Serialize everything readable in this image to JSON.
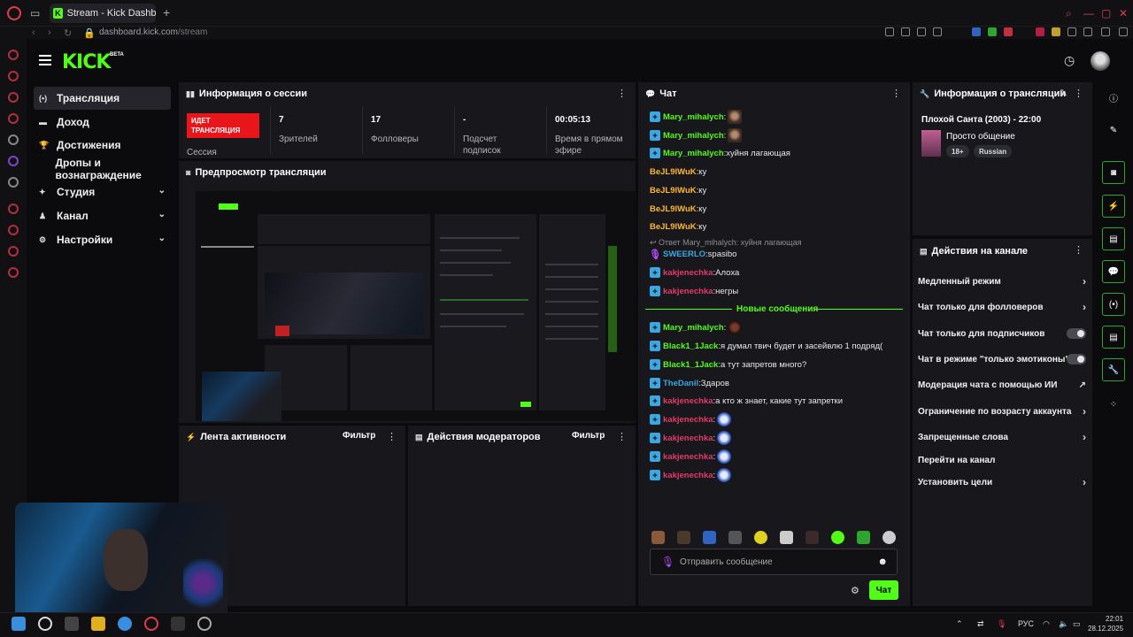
{
  "browser": {
    "tab_title": "Stream - Kick Dashboa",
    "url_domain": "dashboard.kick.com",
    "url_path": "/stream"
  },
  "app": {
    "logo": "KICK",
    "beta": "BETA"
  },
  "sidebar": {
    "items": [
      {
        "label": "Трансляция",
        "icon": "broadcast-icon"
      },
      {
        "label": "Доход",
        "icon": "wallet-icon"
      },
      {
        "label": "Достижения",
        "icon": "trophy-icon"
      },
      {
        "label": "Дропы и вознаграждение",
        "icon": ""
      },
      {
        "label": "Студия",
        "icon": "studio-icon"
      },
      {
        "label": "Канал",
        "icon": "channel-icon"
      },
      {
        "label": "Настройки",
        "icon": "gear-icon"
      }
    ]
  },
  "session": {
    "title": "Информация о сессии",
    "live_label": "ИДЕТ ТРАНСЛЯЦИЯ",
    "session_label": "Сессия",
    "viewers_value": "7",
    "viewers_label": "Зрителей",
    "followers_value": "17",
    "followers_label": "Фолловеры",
    "subs_value": "-",
    "subs_label": "Подсчет подписок",
    "uptime_value": "00:05:13",
    "uptime_label": "Время в прямом эфире"
  },
  "preview": {
    "title": "Предпросмотр трансляции"
  },
  "activity": {
    "title": "Лента активности",
    "filter": "Фильтр"
  },
  "mod_actions": {
    "title": "Действия модераторов",
    "filter": "Фильтр"
  },
  "chat": {
    "title": "Чат",
    "reply_text": "Ответ Mary_mihalych: хуйня лагающая",
    "new_messages": "Новые сообщения",
    "input_placeholder": "Отправить сообщение",
    "send_label": "Чат",
    "messages": [
      {
        "user": "Mary_mihalych",
        "color": "green",
        "text": "",
        "emotes": [
          "face"
        ]
      },
      {
        "user": "Mary_mihalych",
        "color": "green",
        "text": "",
        "emotes": [
          "face"
        ]
      },
      {
        "user": "Mary_mihalych",
        "color": "green",
        "text": "хуйня лагающая",
        "emotes": []
      },
      {
        "user": "BeJL9lWuK",
        "color": "yellow",
        "text": "ку",
        "emotes": [],
        "nobadge": true
      },
      {
        "user": "BeJL9lWuK",
        "color": "yellow",
        "text": "ку",
        "emotes": [],
        "nobadge": true
      },
      {
        "user": "BeJL9lWuK",
        "color": "yellow",
        "text": "ку",
        "emotes": [],
        "nobadge": true
      },
      {
        "user": "BeJL9lWuK",
        "color": "yellow",
        "text": "ку",
        "emotes": [],
        "nobadge": true
      },
      {
        "user": "SWEERLO",
        "color": "cyan",
        "text": "spasibo",
        "emotes": [],
        "purple": true
      },
      {
        "user": "kakjenechka",
        "color": "red",
        "text": "Алоха",
        "emotes": []
      },
      {
        "user": "kakjenechka",
        "color": "red",
        "text": "негры",
        "emotes": []
      },
      {
        "user": "Mary_mihalych",
        "color": "green",
        "text": "",
        "emotes": [
          "dark"
        ]
      },
      {
        "user": "Black1_1Jack",
        "color": "green",
        "text": "я думал твич будет и засейвлю 1 подряд(",
        "emotes": []
      },
      {
        "user": "Black1_1Jack",
        "color": "green",
        "text": "а тут запретов много?",
        "emotes": []
      },
      {
        "user": "TheDanil",
        "color": "cyan",
        "text": "Здаров",
        "emotes": []
      },
      {
        "user": "kakjenechka",
        "color": "red",
        "text": "а кто ж знает, какие тут запретки",
        "emotes": []
      },
      {
        "user": "kakjenechka",
        "color": "red",
        "text": "",
        "emotes": [
          "blue"
        ]
      },
      {
        "user": "kakjenechka",
        "color": "red",
        "text": "",
        "emotes": [
          "blue"
        ]
      },
      {
        "user": "kakjenechka",
        "color": "red",
        "text": "",
        "emotes": [
          "blue"
        ]
      },
      {
        "user": "kakjenechka",
        "color": "red",
        "text": "",
        "emotes": [
          "blue"
        ]
      }
    ]
  },
  "stream_info": {
    "title": "Информация о трансляции",
    "stream_title": "Плохой Санта (2003) - 22:00",
    "category": "Просто общение",
    "tags": [
      "18+",
      "Russian"
    ]
  },
  "channel_actions": {
    "title": "Действия на канале",
    "items": [
      {
        "label": "Медленный режим",
        "right": "chevron"
      },
      {
        "label": "Чат только для фолловеров",
        "right": "chevron"
      },
      {
        "label": "Чат только для подписчиков",
        "right": "toggle"
      },
      {
        "label": "Чат в режиме \"только эмотиконы\"",
        "right": "toggle"
      },
      {
        "label": "Модерация чата с помощью ИИ",
        "right": "external"
      },
      {
        "label": "Ограничение по возрасту аккаунта",
        "right": "chevron"
      },
      {
        "label": "Запрещенные слова",
        "right": "chevron"
      },
      {
        "label": "Перейти на канал",
        "right": "none"
      },
      {
        "label": "Установить цели",
        "right": "chevron"
      }
    ]
  },
  "taskbar": {
    "lang": "РУС",
    "time": "22:01",
    "date": "28.12.2025"
  },
  "colors": {
    "accent": "#53fc18",
    "live": "#e8161b",
    "panel": "#18181c"
  }
}
